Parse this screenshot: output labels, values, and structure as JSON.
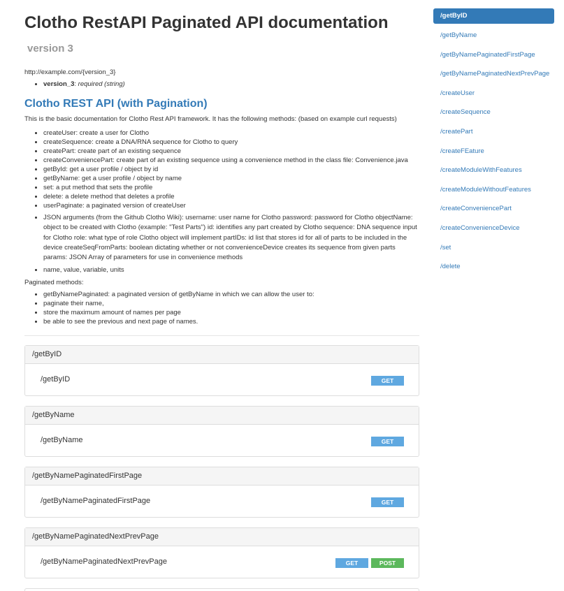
{
  "header": {
    "title": "Clotho RestAPI Paginated API documentation",
    "version": "version 3",
    "base_uri": "http://example.com/{version_3}",
    "param_name": "version_3",
    "param_desc": "required (string)"
  },
  "section": {
    "heading": "Clotho REST API (with Pagination)",
    "description": "This is the basic documentation for Clotho Rest API framework. It has the following methods: (based on example curl requests)",
    "methods": [
      "createUser: create a user for Clotho",
      "createSequence: create a DNA/RNA sequence for Clotho to query",
      "createPart: create part of an existing sequence",
      "createConveniencePart: create part of an existing sequence using a convenience method in the class file: Convenience.java",
      "getById: get a user profile / object by id",
      "getByName: get a user profile / object by name",
      "set: a put method that sets the profile",
      "delete: a delete method that deletes a profile",
      "userPaginate: a paginated version of createUser"
    ],
    "json_args": "JSON arguments (from the Github Clotho Wiki): username: user name for Clotho password: password for Clotho objectName: object to be created with Clotho (example: \"Test Parts\") id: identifies any part created by Clotho sequence: DNA sequence input for Clotho role: what type of role Clotho object will implement partIDs: id list that stores id for all of parts to be included in the device createSeqFromParts: boolean dictating whether or not convenienceDevice creates its sequence from given parts params: JSON Array of parameters for use in convenience methods",
    "name_value": "name, value, variable, units",
    "paginated_label": "Paginated methods:",
    "paginated": [
      "getByNamePaginated: a paginated version of getByName in which we can allow the user to:",
      "paginate their name,",
      "store the maximum amount of names per page",
      "be able to see the previous and next page of names."
    ]
  },
  "resources": [
    {
      "heading": "/getByID",
      "path": "/getByID",
      "methods": [
        "GET"
      ]
    },
    {
      "heading": "/getByName",
      "path": "/getByName",
      "methods": [
        "GET"
      ]
    },
    {
      "heading": "/getByNamePaginatedFirstPage",
      "path": "/getByNamePaginatedFirstPage",
      "methods": [
        "GET"
      ]
    },
    {
      "heading": "/getByNamePaginatedNextPrevPage",
      "path": "/getByNamePaginatedNextPrevPage",
      "methods": [
        "GET",
        "POST"
      ]
    }
  ],
  "sidebar": {
    "items": [
      "/getByID",
      "/getByName",
      "/getByNamePaginatedFirstPage",
      "/getByNamePaginatedNextPrevPage",
      "/createUser",
      "/createSequence",
      "/createPart",
      "/createFEature",
      "/createModuleWithFeatures",
      "/createModuleWithoutFeatures",
      "/createConveniencePart",
      "/createConvenienceDevice",
      "/set",
      "/delete"
    ],
    "active_index": 0
  },
  "colors": {
    "link": "#337ab7",
    "get": "#5fa8e0",
    "post": "#5cb85c"
  }
}
